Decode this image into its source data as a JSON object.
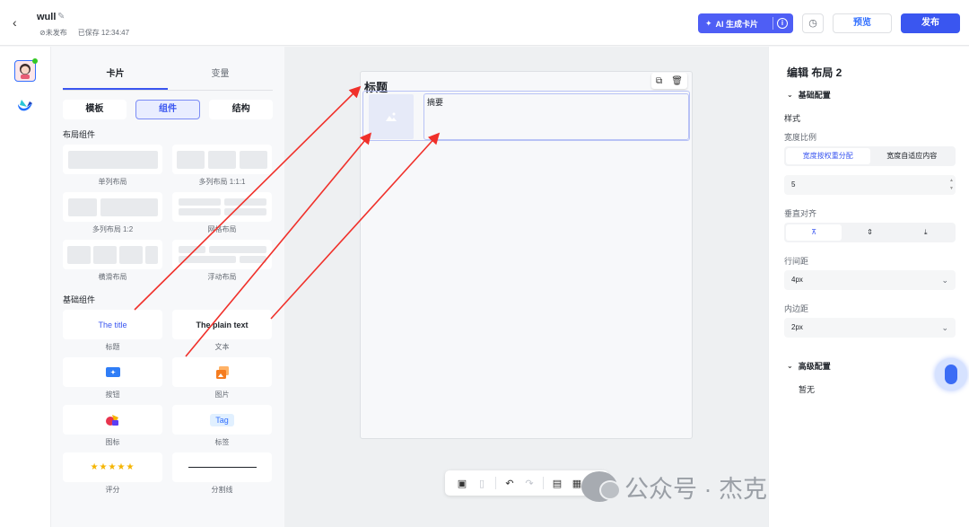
{
  "header": {
    "back_icon": "chevron-left-icon",
    "doc_name": "wull",
    "edit_icon": "edit-icon",
    "status": "⊘未发布",
    "saved": "已保存 12:34:47",
    "ai_button": "AI 生成卡片",
    "info_glyph": "i",
    "history_icon": "history-icon",
    "preview": "预览",
    "publish": "发布"
  },
  "panel": {
    "tabs": [
      "卡片",
      "变量"
    ],
    "active_tab": 0,
    "segments": [
      "模板",
      "组件",
      "结构"
    ],
    "active_segment": 1,
    "layout_section": "布局组件",
    "basic_section": "基础组件",
    "layout_items": [
      "单列布局",
      "多列布局 1:1:1",
      "多列布局 1:2",
      "网格布局",
      "横滑布局",
      "浮动布局"
    ],
    "basic_items": [
      "标题",
      "文本",
      "按钮",
      "图片",
      "图标",
      "标签",
      "评分",
      "分割线"
    ],
    "title_sample": "The title",
    "plain_sample": "The plain text",
    "tag_sample": "Tag",
    "stars_sample": "★★★★★"
  },
  "canvas": {
    "card_title": "标题",
    "summary": "摘要",
    "tool_icons": [
      "copy-icon",
      "trash-icon"
    ],
    "toolbar_icons": [
      "desktop-icon",
      "mobile-icon",
      "undo-icon",
      "redo-icon",
      "document-icon",
      "export-icon"
    ],
    "watermark": "公众号 · 杰克船长的AIGC"
  },
  "config": {
    "title": "编辑 布局 2",
    "basic_group": "基础配置",
    "style_label": "样式",
    "width_ratio_label": "宽度比例",
    "width_options": [
      "宽度按权重分配",
      "宽度自适应内容"
    ],
    "width_active": 0,
    "weight_value": "5",
    "valign_label": "垂直对齐",
    "valign_options": [
      "top-align-icon",
      "center-align-icon",
      "bottom-align-icon"
    ],
    "row_gap_label": "行间距",
    "row_gap_value": "4px",
    "padding_label": "内边距",
    "padding_value": "2px",
    "advanced_group": "高级配置",
    "advanced_empty": "暂无"
  },
  "colors": {
    "accent": "#3a56f0",
    "annotation_arrow": "#f0302a"
  }
}
